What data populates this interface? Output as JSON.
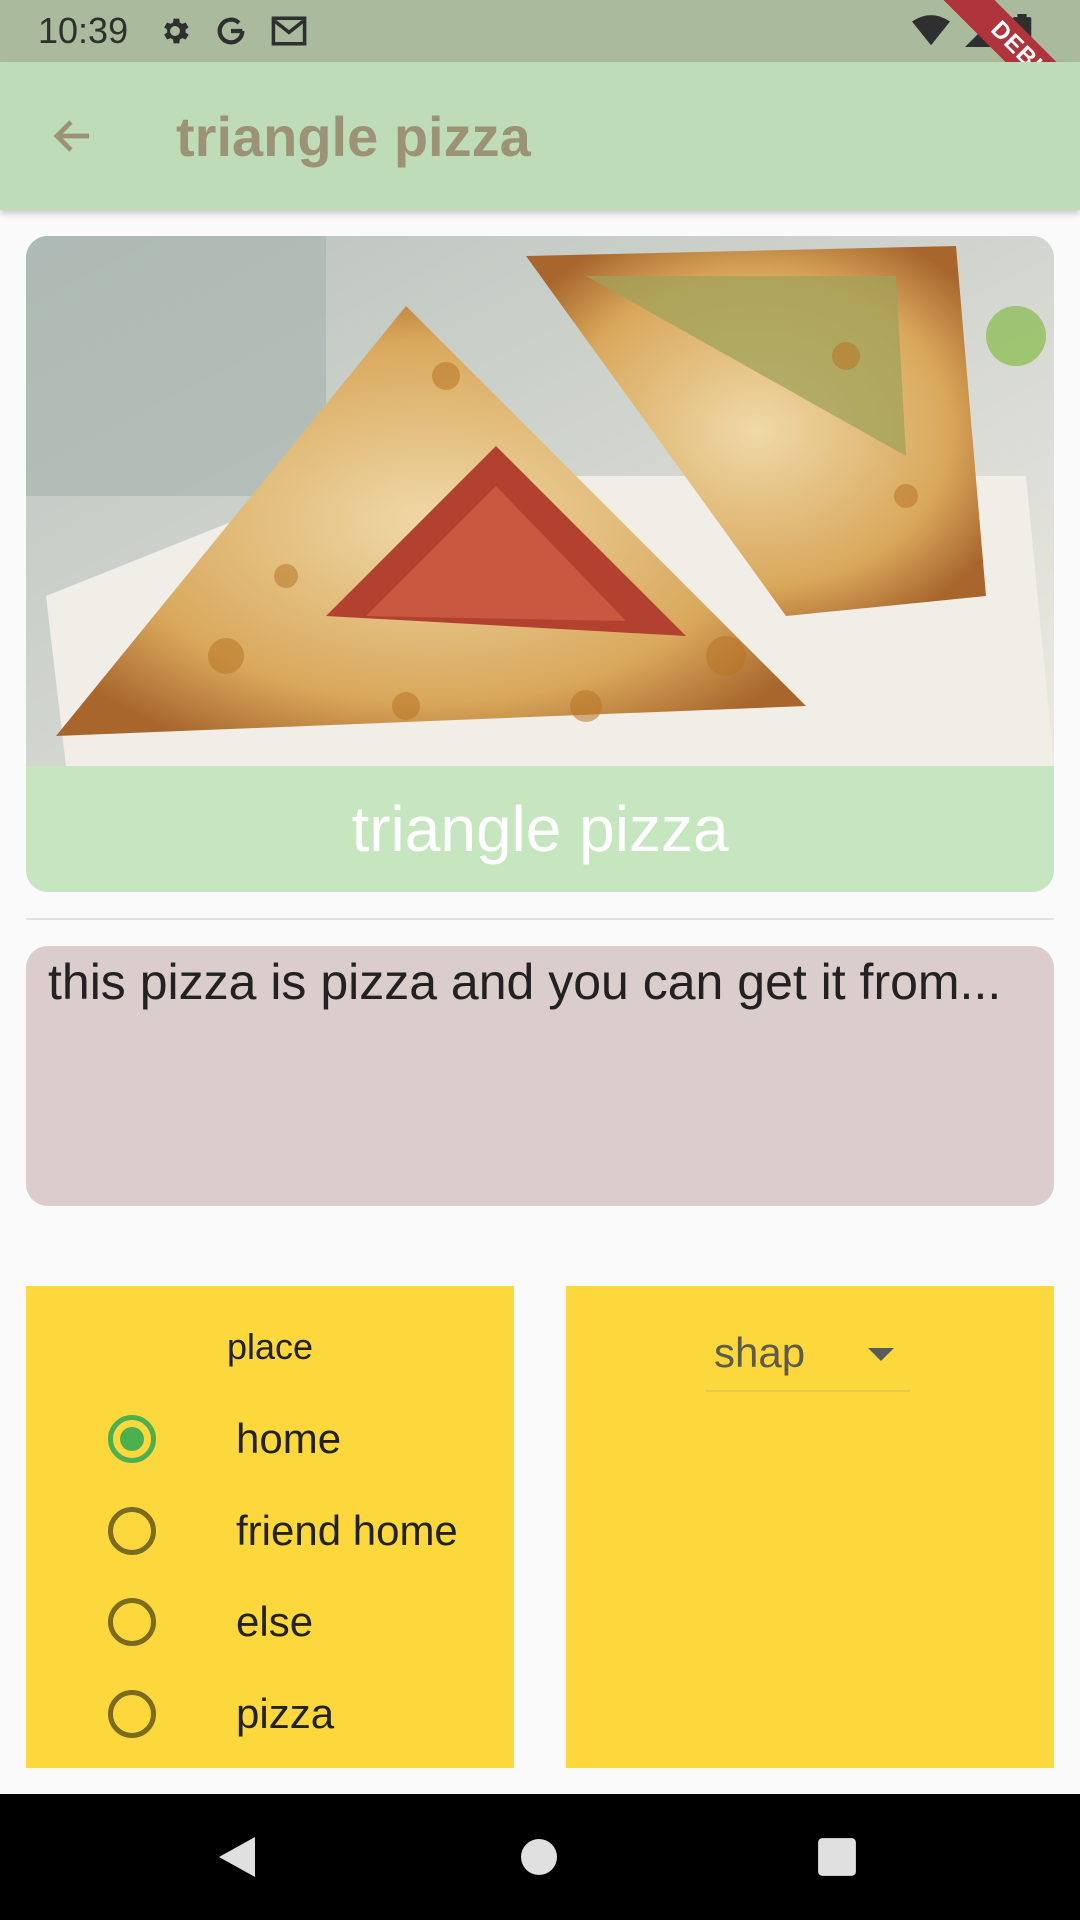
{
  "status_bar": {
    "time": "10:39",
    "icons_left": [
      "gear-icon",
      "google-icon",
      "gmail-icon"
    ],
    "icons_right": [
      "wifi-icon",
      "signal-icon",
      "battery-icon"
    ],
    "debug_label": "DEBUG"
  },
  "app_bar": {
    "title": "triangle pizza",
    "back_icon": "arrow-back-icon"
  },
  "image_card": {
    "caption": "triangle pizza"
  },
  "description": {
    "text": "this pizza is pizza and you can get it from..."
  },
  "place_panel": {
    "title": "place",
    "options": [
      {
        "label": "home",
        "selected": true
      },
      {
        "label": "friend home",
        "selected": false
      },
      {
        "label": "else",
        "selected": false
      },
      {
        "label": "pizza",
        "selected": false
      }
    ]
  },
  "shape_panel": {
    "dropdown_value": "shap"
  },
  "colors": {
    "app_bar": "#bfdcb8",
    "panel": "#fdd83d",
    "radio_selected": "#4cb050",
    "description_bg": "#dbcdcc"
  },
  "nav_bar": {
    "icons": [
      "back-triangle-icon",
      "home-circle-icon",
      "recents-square-icon"
    ]
  }
}
